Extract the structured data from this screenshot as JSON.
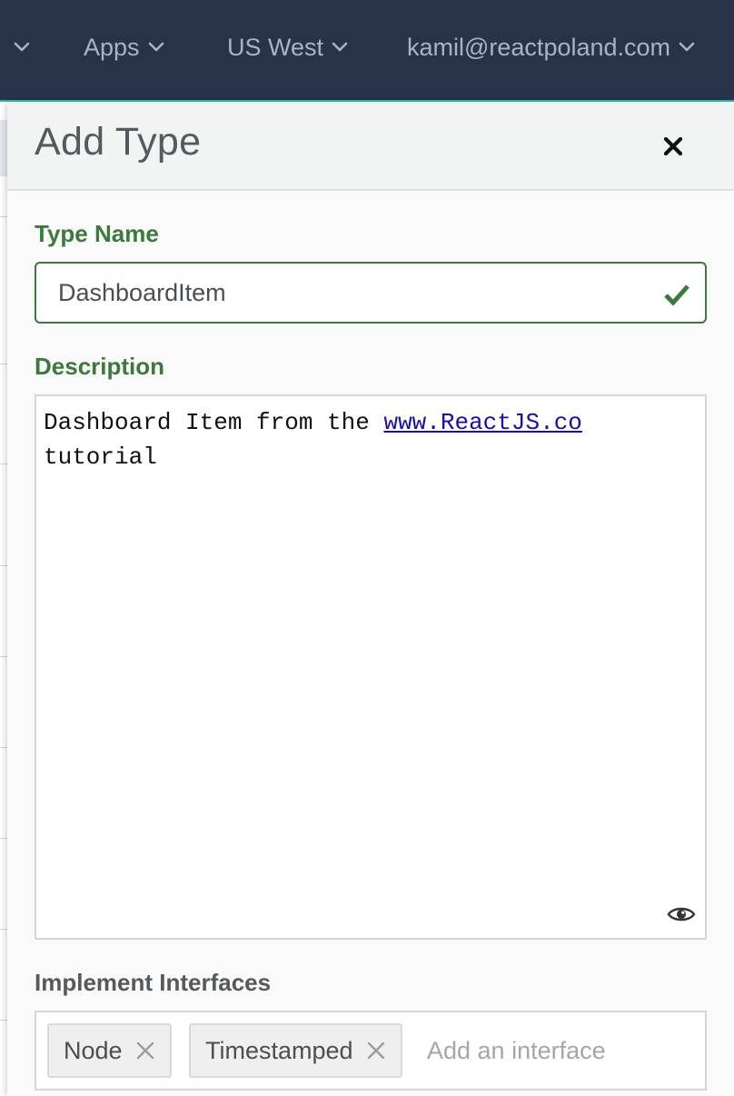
{
  "nav": {
    "items": [
      {
        "label": ""
      },
      {
        "label": "Apps"
      },
      {
        "label": "US West"
      },
      {
        "label": "kamil@reactpoland.com"
      }
    ]
  },
  "drawer": {
    "title": "Add Type",
    "close_icon": "close-icon"
  },
  "type_name": {
    "label": "Type Name",
    "value": "DashboardItem",
    "status_icon": "checkmark-icon",
    "valid_color": "#3b7a3a"
  },
  "description": {
    "label": "Description",
    "text_before": "Dashboard Item from the ",
    "link_text": "www.ReactJS.co",
    "text_after": "\ntutorial",
    "preview_icon": "eye-icon"
  },
  "interfaces": {
    "label": "Implement Interfaces",
    "tags": [
      {
        "label": "Node"
      },
      {
        "label": "Timestamped"
      }
    ],
    "placeholder": "Add an interface"
  },
  "colors": {
    "nav_background": "#283349",
    "accent": "#27b9a6",
    "label_green": "#3b7a3a"
  }
}
